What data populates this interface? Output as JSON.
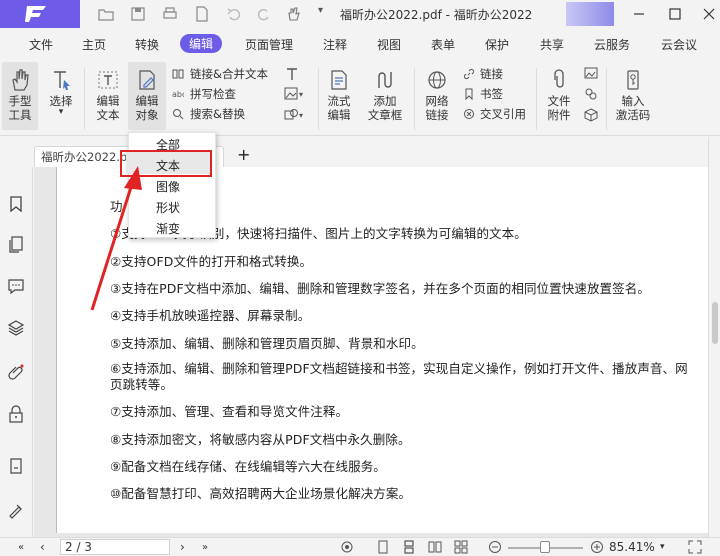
{
  "titlebar": {
    "doc_title": "福昕办公2022.pdf - 福昕办公2022",
    "app_logo_letter": "F"
  },
  "menu": {
    "items": [
      "文件",
      "主页",
      "转换",
      "编辑",
      "页面管理",
      "注释",
      "视图",
      "表单",
      "保护",
      "共享",
      "云服务",
      "云会议"
    ],
    "active": "编辑"
  },
  "ribbon": {
    "hand_tool": "手型\n工具",
    "select_tool": "选择",
    "edit_text": "编辑\n文本",
    "edit_object": "编辑\n对象",
    "link_merge_text": "链接&合并文本",
    "spell_check": "拼写检查",
    "search_replace": "搜索&替换",
    "flow_edit": "流式\n编辑",
    "add_textbox": "添加\n文章框",
    "web_link": "网络\n链接",
    "link": "链接",
    "bookmark": "书签",
    "cross_ref": "交叉引用",
    "file_attach": "文件\n附件",
    "activation_code": "输入\n激活码"
  },
  "tabs": {
    "doc_tab": "福昕办公2022.pdf",
    "close": "×",
    "add": "+"
  },
  "dropdown": {
    "items": [
      "全部",
      "文本",
      "图像",
      "形状",
      "渐变"
    ],
    "highlighted": "文本"
  },
  "document": {
    "heading_partial": "功",
    "lines": [
      "①支持OCR文字识别，快速将扫描件、图片上的文字转换为可编辑的文本。",
      "②支持OFD文件的打开和格式转换。",
      "③支持在PDF文档中添加、编辑、删除和管理数字签名，并在多个页面的相同位置快速放置签名。",
      "④支持手机放映遥控器、屏幕录制。",
      "⑤支持添加、编辑、删除和管理页眉页脚、背景和水印。",
      "⑥支持添加、编辑、删除和管理PDF文档超链接和书签，实现自定义操作，例如打开文件、播放声音、网页跳转等。",
      "⑦支持添加、管理、查看和导览文件注释。",
      "⑧支持添加密文，将敏感内容从PDF文档中永久删除。",
      "⑨配备文档在线存储、在线编辑等六大在线服务。",
      "⑩配备智慧打印、高效招聘两大企业场景化解决方案。"
    ]
  },
  "status": {
    "page_indicator": "2 / 3",
    "zoom": "85.41%"
  },
  "colors": {
    "brand": "#6c5ce7",
    "highlight_red": "#e02424"
  }
}
